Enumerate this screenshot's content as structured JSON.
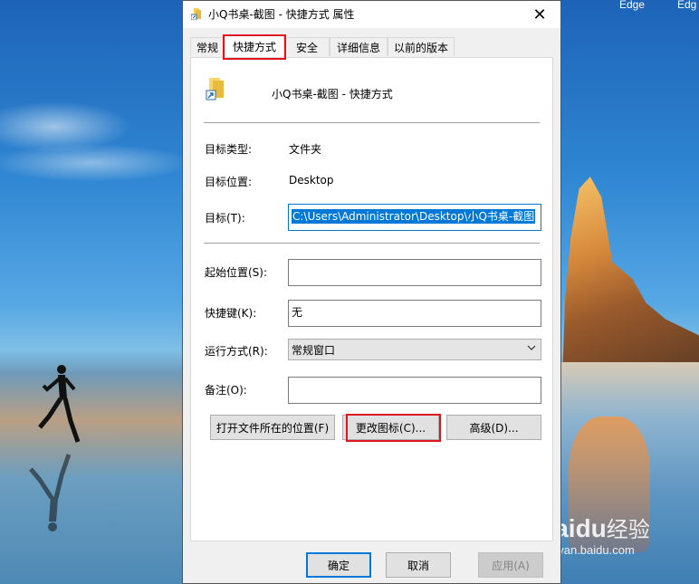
{
  "desktop": {
    "top_labels": [
      "Edge",
      "Edg"
    ],
    "watermark": {
      "logo": "Bai",
      "paw": "du",
      "cn": "经验",
      "url": "jingyan.baidu.com"
    }
  },
  "dialog": {
    "title": "小Q书桌-截图 - 快捷方式 属性",
    "close_glyph": "✕",
    "tabs": [
      {
        "label": "常规"
      },
      {
        "label": "快捷方式",
        "active": true
      },
      {
        "label": "安全"
      },
      {
        "label": "详细信息"
      },
      {
        "label": "以前的版本"
      }
    ],
    "shortcut": {
      "name": "小Q书桌-截图 - 快捷方式",
      "icon": "folder-shortcut-icon"
    },
    "fields": {
      "target_type_label": "目标类型:",
      "target_type_value": "文件夹",
      "target_location_label": "目标位置:",
      "target_location_value": "Desktop",
      "target_label": "目标(T):",
      "target_value": "C:\\Users\\Administrator\\Desktop\\小Q书桌-截图",
      "start_in_label": "起始位置(S):",
      "start_in_value": "",
      "hotkey_label": "快捷键(K):",
      "hotkey_value": "无",
      "run_label": "运行方式(R):",
      "run_value": "常规窗口",
      "comment_label": "备注(O):",
      "comment_value": ""
    },
    "buttons": {
      "open_location": "打开文件所在的位置(F)",
      "change_icon": "更改图标(C)...",
      "advanced": "高级(D)..."
    },
    "footer": {
      "ok": "确定",
      "cancel": "取消",
      "apply": "应用(A)"
    },
    "colors": {
      "highlight": "#e0161d",
      "selection": "#0078d7"
    }
  }
}
